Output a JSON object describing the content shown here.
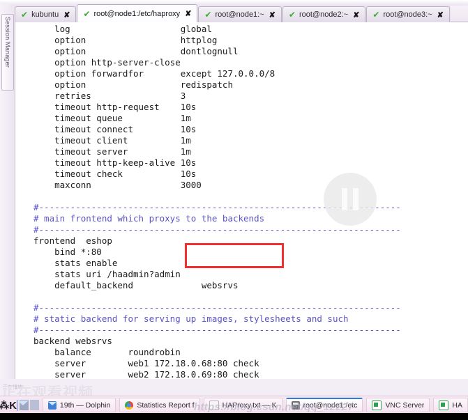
{
  "window": {
    "sidebar_label": "Session Manager"
  },
  "tabs": [
    {
      "label": "kubuntu",
      "active": false,
      "check": "✔",
      "close": "✘"
    },
    {
      "label": "root@node1:/etc/haproxy",
      "active": true,
      "check": "✔",
      "close": "✘"
    },
    {
      "label": "root@node1:~",
      "active": false,
      "check": "✔",
      "close": "✘"
    },
    {
      "label": "root@node2:~",
      "active": false,
      "check": "✔",
      "close": "✘"
    },
    {
      "label": "root@node3:~",
      "active": false,
      "check": "✔",
      "close": "✘"
    }
  ],
  "terminal": {
    "lines": [
      {
        "text": "    log                     global",
        "comment": false
      },
      {
        "text": "    option                  httplog",
        "comment": false
      },
      {
        "text": "    option                  dontlognull",
        "comment": false
      },
      {
        "text": "    option http-server-close",
        "comment": false
      },
      {
        "text": "    option forwardfor       except 127.0.0.0/8",
        "comment": false
      },
      {
        "text": "    option                  redispatch",
        "comment": false
      },
      {
        "text": "    retries                 3",
        "comment": false
      },
      {
        "text": "    timeout http-request    10s",
        "comment": false
      },
      {
        "text": "    timeout queue           1m",
        "comment": false
      },
      {
        "text": "    timeout connect         10s",
        "comment": false
      },
      {
        "text": "    timeout client          1m",
        "comment": false
      },
      {
        "text": "    timeout server          1m",
        "comment": false
      },
      {
        "text": "    timeout http-keep-alive 10s",
        "comment": false
      },
      {
        "text": "    timeout check           10s",
        "comment": false
      },
      {
        "text": "    maxconn                 3000",
        "comment": false
      },
      {
        "text": "",
        "comment": false
      },
      {
        "text": "#---------------------------------------------------------------------",
        "comment": true
      },
      {
        "text": "# main frontend which proxys to the backends",
        "comment": true
      },
      {
        "text": "#---------------------------------------------------------------------",
        "comment": true
      },
      {
        "text": "frontend  eshop",
        "comment": false
      },
      {
        "text": "    bind *:80",
        "comment": false
      },
      {
        "text": "    stats enable",
        "comment": false
      },
      {
        "text": "    stats uri /haadmin?admin",
        "comment": false
      },
      {
        "text": "    default_backend             websrvs",
        "comment": false
      },
      {
        "text": "",
        "comment": false
      },
      {
        "text": "#---------------------------------------------------------------------",
        "comment": true
      },
      {
        "text": "# static backend for serving up images, stylesheets and such",
        "comment": true
      },
      {
        "text": "#---------------------------------------------------------------------",
        "comment": true
      },
      {
        "text": "backend websrvs",
        "comment": false
      },
      {
        "text": "    balance       roundrobin",
        "comment": false
      },
      {
        "text": "    server        web1 172.18.0.68:80 check",
        "comment": false
      },
      {
        "text": "    server        web2 172.18.0.69:80 check",
        "comment": false
      }
    ]
  },
  "annotation": {
    "highlight_color": "#f22e2e",
    "note": ""
  },
  "overlay": {
    "pause_icon": "pause",
    "cn_watermark": "正在观看视频",
    "cn_watermark_small": "正在播放",
    "url_watermark": "https://blog.csdn.net/qq_12227"
  },
  "taskbar": {
    "menu_glyph": "⁂K",
    "items": [
      {
        "label": "19th — Dolphin",
        "icon": "folder-icon",
        "active": false
      },
      {
        "label": "Statistics Report f",
        "icon": "chrome-icon",
        "active": false
      },
      {
        "label": "HAProxy.txt — K",
        "icon": "text-file-icon",
        "active": false
      },
      {
        "label": "root@node1:/etc",
        "icon": "terminal-icon",
        "active": true
      },
      {
        "label": "VNC Server",
        "icon": "vnc-icon",
        "active": false
      },
      {
        "label": "HA",
        "icon": "vnc-icon",
        "active": false
      }
    ]
  }
}
